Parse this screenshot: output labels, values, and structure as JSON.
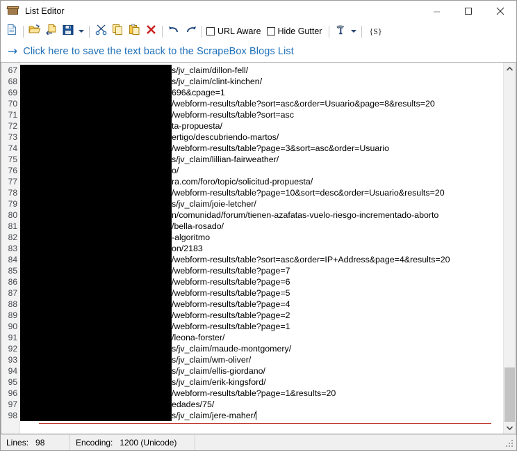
{
  "window": {
    "title": "List Editor",
    "icon": "box-icon",
    "controls": {
      "minimize": "minimize-icon",
      "maximize": "maximize-icon",
      "close": "close-icon"
    }
  },
  "toolbar": {
    "buttons": [
      {
        "name": "new-file-button",
        "icon": "new-document-icon",
        "label": "New"
      },
      {
        "name": "open-file-button",
        "icon": "open-folder-icon",
        "label": "Open"
      },
      {
        "name": "save-as-button",
        "icon": "save-as-icon",
        "label": "Save As"
      },
      {
        "name": "save-button",
        "icon": "floppy-disk-icon",
        "label": "Save"
      },
      {
        "name": "cut-button",
        "icon": "scissors-icon",
        "label": "Cut"
      },
      {
        "name": "copy-button",
        "icon": "copy-icon",
        "label": "Copy"
      },
      {
        "name": "paste-button",
        "icon": "paste-icon",
        "label": "Paste"
      },
      {
        "name": "delete-button",
        "icon": "red-x-icon",
        "label": "Delete"
      },
      {
        "name": "undo-button",
        "icon": "undo-arrow-icon",
        "label": "Undo"
      },
      {
        "name": "redo-button",
        "icon": "redo-arrow-icon",
        "label": "Redo"
      }
    ],
    "url_aware_label": "URL Aware",
    "url_aware_checked": false,
    "hide_gutter_label": "Hide Gutter",
    "hide_gutter_checked": false,
    "tools_icon": "hammer-tool-icon",
    "script_button_label": "{S}"
  },
  "linkbar": {
    "arrow": "→",
    "text": "Click here to save the text back to the ScrapeBox Blogs List"
  },
  "editor": {
    "first_line_number": 67,
    "redacted_prefix_note": "black-redaction-block",
    "lines": [
      {
        "n": 67,
        "text": "s/jv_claim/dillon-fell/"
      },
      {
        "n": 68,
        "text": "s/jv_claim/clint-kinchen/"
      },
      {
        "n": 69,
        "text": "696&cpage=1"
      },
      {
        "n": 70,
        "text": "/webform-results/table?sort=asc&order=Usuario&page=8&results=20"
      },
      {
        "n": 71,
        "text": "/webform-results/table?sort=asc"
      },
      {
        "n": 72,
        "text": "ta-propuesta/"
      },
      {
        "n": 73,
        "text": "ertigo/descubriendo-martos/"
      },
      {
        "n": 74,
        "text": "/webform-results/table?page=3&sort=asc&order=Usuario"
      },
      {
        "n": 75,
        "text": "s/jv_claim/lillian-fairweather/"
      },
      {
        "n": 76,
        "text": "o/"
      },
      {
        "n": 77,
        "text": "ra.com/foro/topic/solicitud-propuesta/"
      },
      {
        "n": 78,
        "text": "/webform-results/table?page=10&sort=desc&order=Usuario&results=20"
      },
      {
        "n": 79,
        "text": "s/jv_claim/joie-letcher/"
      },
      {
        "n": 80,
        "text": "n/comunidad/forum/tienen-azafatas-vuelo-riesgo-incrementado-aborto"
      },
      {
        "n": 81,
        "text": "/bella-rosado/"
      },
      {
        "n": 82,
        "text": "-algoritmo"
      },
      {
        "n": 83,
        "text": "on/2183"
      },
      {
        "n": 84,
        "text": "/webform-results/table?sort=asc&order=IP+Address&page=4&results=20"
      },
      {
        "n": 85,
        "text": "/webform-results/table?page=7"
      },
      {
        "n": 86,
        "text": "/webform-results/table?page=6"
      },
      {
        "n": 87,
        "text": "/webform-results/table?page=5"
      },
      {
        "n": 88,
        "text": "/webform-results/table?page=4"
      },
      {
        "n": 89,
        "text": "/webform-results/table?page=2"
      },
      {
        "n": 90,
        "text": "/webform-results/table?page=1"
      },
      {
        "n": 91,
        "text": "/leona-forster/"
      },
      {
        "n": 92,
        "text": "s/jv_claim/maude-montgomery/"
      },
      {
        "n": 93,
        "text": "s/jv_claim/wm-oliver/"
      },
      {
        "n": 94,
        "text": "s/jv_claim/ellis-giordano/"
      },
      {
        "n": 95,
        "text": "s/jv_claim/erik-kingsford/"
      },
      {
        "n": 96,
        "text": "/webform-results/table?page=1&results=20"
      },
      {
        "n": 97,
        "text": "edades/75/"
      },
      {
        "n": 98,
        "text": "s/jv_claim/jere-maher/"
      }
    ]
  },
  "statusbar": {
    "lines_label": "Lines:",
    "lines_value": "98",
    "encoding_label": "Encoding:",
    "encoding_value": "1200 (Unicode)"
  },
  "colors": {
    "link": "#1e6fb8",
    "redaction": "#000000",
    "red_rule": "#c03a2f",
    "gutter_bg": "#f3f3f3",
    "statusbar_bg": "#f0f0f0"
  }
}
